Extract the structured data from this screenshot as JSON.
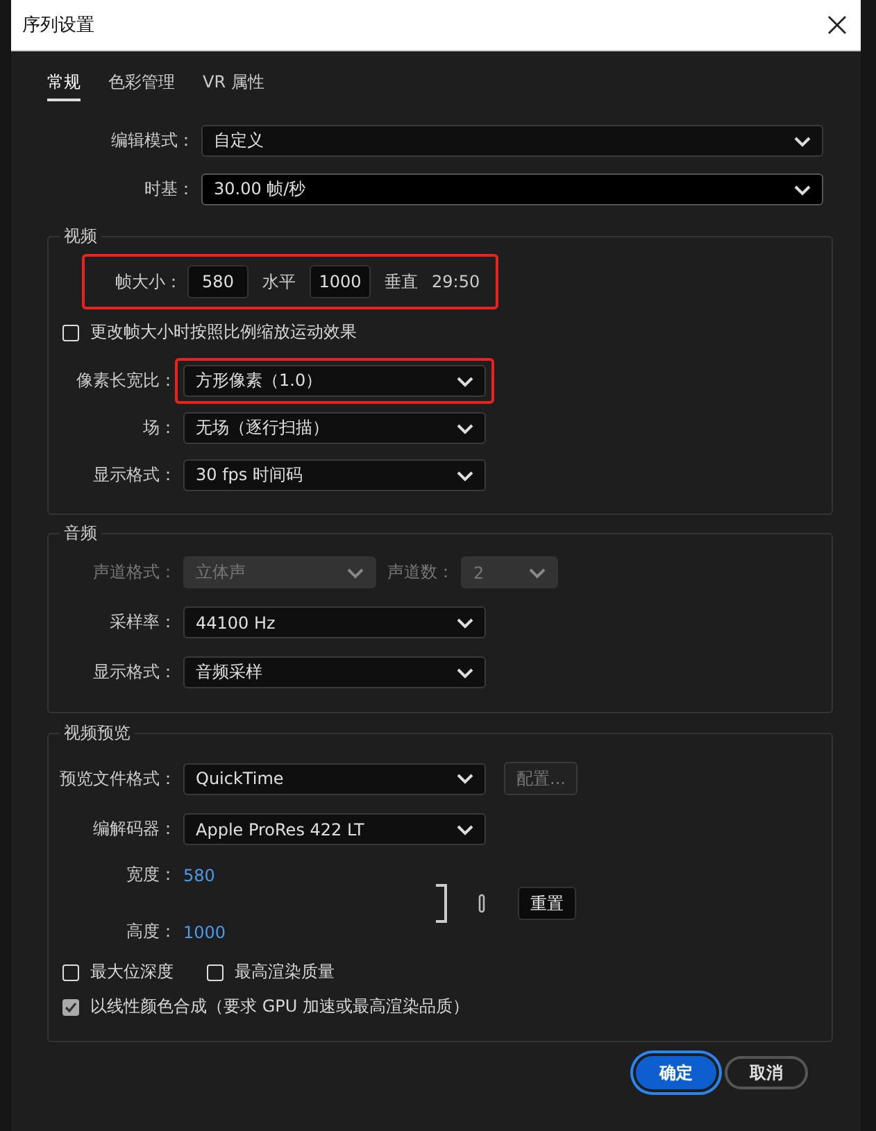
{
  "window": {
    "title": "序列设置"
  },
  "tabs": [
    {
      "label": "常规",
      "selected": true
    },
    {
      "label": "色彩管理",
      "selected": false
    },
    {
      "label": "VR 属性",
      "selected": false
    }
  ],
  "edit_mode": {
    "label": "编辑模式：",
    "value": "自定义"
  },
  "timebase": {
    "label": "时基：",
    "value": "30.00  帧/秒"
  },
  "video": {
    "title": "视频",
    "frame_size": {
      "label": "帧大小：",
      "horizontal": "580",
      "horizontal_label": "水平",
      "vertical": "1000",
      "vertical_label": "垂直",
      "ratio": "29:50",
      "highlighted": true
    },
    "scale_checkbox": {
      "label": "更改帧大小时按照比例缩放运动效果",
      "checked": false
    },
    "selects": [
      {
        "label": "像素长宽比：",
        "value": "方形像素（1.0）",
        "highlighted": true
      },
      {
        "label": "场：",
        "value": "无场（逐行扫描）",
        "highlighted": false
      },
      {
        "label": "显示格式：",
        "value": "30 fps 时间码",
        "highlighted": false
      }
    ]
  },
  "audio": {
    "title": "音频",
    "channel_format": {
      "label": "声道格式：",
      "value": "立体声",
      "disabled": true
    },
    "channel_count": {
      "label": "声道数：",
      "value": "2",
      "disabled": true
    },
    "selects": [
      {
        "label": "采样率：",
        "value": "44100 Hz"
      },
      {
        "label": "显示格式：",
        "value": "音频采样"
      }
    ]
  },
  "preview": {
    "title": "视频预览",
    "file_format": {
      "label": "预览文件格式：",
      "value": "QuickTime"
    },
    "config_button": {
      "label": "配置...",
      "disabled": true
    },
    "codec": {
      "label": "编解码器：",
      "value": "Apple ProRes 422 LT"
    },
    "width": {
      "label": "宽度：",
      "value": "580"
    },
    "height": {
      "label": "高度：",
      "value": "1000"
    },
    "reset_button": "重置",
    "checkboxes": [
      {
        "label": "最大位深度",
        "checked": false,
        "disabled": false
      },
      {
        "label": "最高渲染质量",
        "checked": false,
        "disabled": false
      },
      {
        "label": "以线性颜色合成（要求 GPU 加速或最高渲染品质）",
        "checked": true,
        "disabled": true
      }
    ]
  },
  "buttons": [
    {
      "label": "确定",
      "kind": "primary"
    },
    {
      "label": "取消",
      "kind": "secondary"
    }
  ]
}
